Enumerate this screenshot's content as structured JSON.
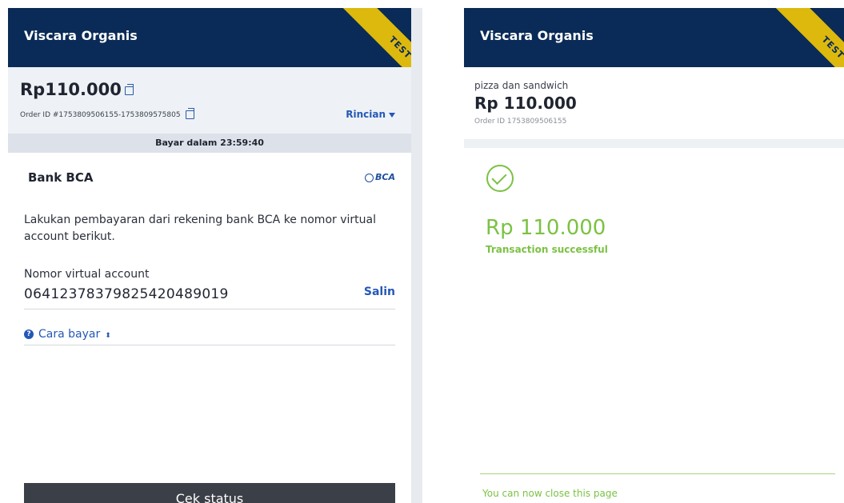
{
  "left": {
    "header_title": "Viscara Organis",
    "ribbon": "TEST",
    "amount": "Rp110.000",
    "order_id": "Order ID #1753809506155-1753809575805",
    "details_label": "Rincian",
    "countdown": "Bayar dalam 23:59:40",
    "bank_name": "Bank BCA",
    "bank_logo": "BCA",
    "instruction": "Lakukan pembayaran dari rekening bank BCA ke nomor virtual account berikut.",
    "va_label": "Nomor virtual account",
    "va_number": "06412378379825420489019",
    "copy_label": "Salin",
    "how_to_pay": "Cara bayar",
    "check_status": "Cek status"
  },
  "right": {
    "header_title": "Viscara Organis",
    "ribbon": "TEST",
    "item_name": "pizza dan sandwich",
    "amount": "Rp 110.000",
    "order_id": "Order ID 1753809506155",
    "success_amount": "Rp 110.000",
    "status": "Transaction successful",
    "close_hint": "You can now close this page"
  },
  "colors": {
    "header_bg": "#0a2b57",
    "ribbon": "#ddb90d",
    "link_blue": "#2458b7",
    "success_green": "#7bc244",
    "button_dark": "#3b3f47"
  },
  "icons": [
    "copy-icon",
    "caret-down-icon",
    "bca-logo",
    "help-icon",
    "sort-icon",
    "checkmark-circle-icon"
  ]
}
